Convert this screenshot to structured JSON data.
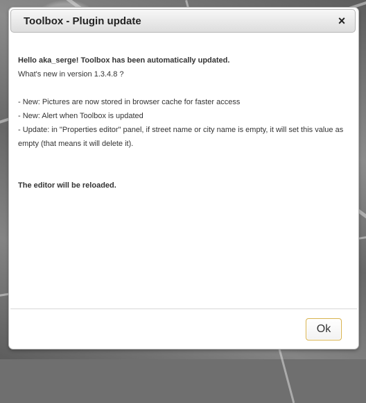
{
  "dialog": {
    "title": "Toolbox - Plugin update",
    "close_icon": "×",
    "greeting": "Hello aka_serge! Toolbox has been automatically updated.",
    "version_line": "What's new in version 1.3.4.8 ?",
    "changes": [
      "- New: Pictures are now stored in browser cache for faster access",
      "- New: Alert when Toolbox is updated",
      "- Update: in \"Properties editor\" panel, if street name or city name is empty, it will set this value as empty (that means it will delete it)."
    ],
    "reload_notice": "The editor will be reloaded.",
    "ok_label": "Ok"
  },
  "colors": {
    "title_text": "#222222",
    "body_text": "#333333",
    "button_border": "#d8b24d",
    "dialog_border": "#b8b8b8"
  },
  "icons": {
    "close": "close-icon"
  }
}
